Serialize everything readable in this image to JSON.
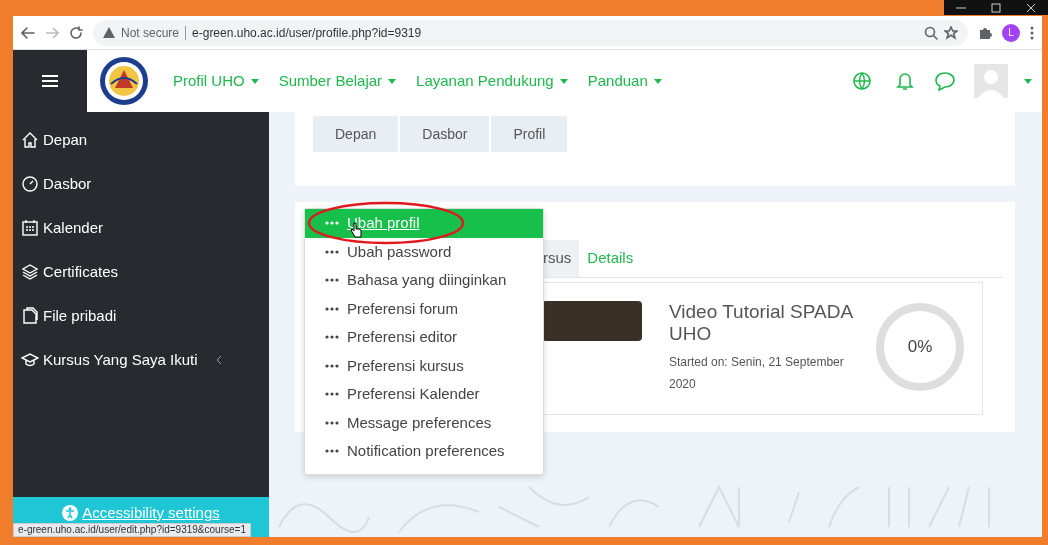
{
  "browser": {
    "security": "Not secure",
    "url": "e-green.uho.ac.id/user/profile.php?id=9319",
    "profile_initial": "L"
  },
  "navbar": {
    "menus": [
      {
        "label": "Profil UHO"
      },
      {
        "label": "Sumber Belajar"
      },
      {
        "label": "Layanan Pendukung"
      },
      {
        "label": "Panduan"
      }
    ]
  },
  "sidebar": {
    "items": [
      {
        "label": "Depan",
        "has_submenu": false
      },
      {
        "label": "Dasbor",
        "has_submenu": false
      },
      {
        "label": "Kalender",
        "has_submenu": false
      },
      {
        "label": "Certificates",
        "has_submenu": false
      },
      {
        "label": "File pribadi",
        "has_submenu": false
      },
      {
        "label": "Kursus Yang Saya Ikuti",
        "has_submenu": true
      }
    ],
    "accessibility": "Accessibility settings"
  },
  "breadcrumb": [
    "Depan",
    "Dasbor",
    "Profil"
  ],
  "tabs": [
    {
      "label": "rsus",
      "selected": true
    },
    {
      "label": "Details",
      "selected": false
    }
  ],
  "course": {
    "title": "Video Tutorial SPADA UHO",
    "started": "Started on: Senin, 21 September 2020",
    "progress": "0%",
    "level": 0
  },
  "menu": {
    "items": [
      {
        "label": "Ubah profil",
        "selected": true
      },
      {
        "label": "Ubah password",
        "selected": false
      },
      {
        "label": "Bahasa yang diinginkan",
        "selected": false
      },
      {
        "label": "Preferensi forum",
        "selected": false
      },
      {
        "label": "Preferensi editor",
        "selected": false
      },
      {
        "label": "Preferensi kursus",
        "selected": false
      },
      {
        "label": "Preferensi Kalender",
        "selected": false
      },
      {
        "label": "Message preferences",
        "selected": false
      },
      {
        "label": "Notification preferences",
        "selected": false
      }
    ]
  },
  "status_url": "e-green.uho.ac.id/user/edit.php?id=9319&course=1"
}
